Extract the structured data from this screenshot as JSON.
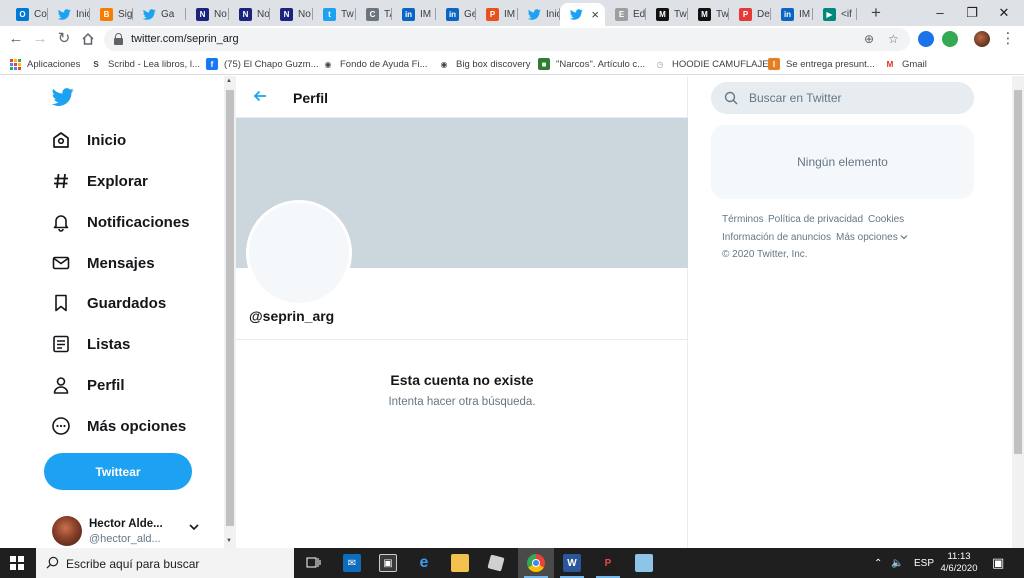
{
  "browser": {
    "tabs": [
      {
        "label": "Co",
        "icon": "outlook-icon",
        "color": "#0078d4",
        "glyph": "O"
      },
      {
        "label": "Inic",
        "icon": "twitter-icon",
        "color": "#1da1f2",
        "glyph": ""
      },
      {
        "label": "Sig",
        "icon": "blogger-icon",
        "color": "#f57d00",
        "glyph": "B"
      },
      {
        "label": "Ga",
        "icon": "twitter-icon",
        "color": "#1da1f2",
        "glyph": ""
      },
      {
        "label": "No",
        "icon": "news-icon",
        "color": "#1a237e",
        "glyph": "N"
      },
      {
        "label": "No",
        "icon": "news-icon",
        "color": "#1a237e",
        "glyph": "N"
      },
      {
        "label": "No",
        "icon": "news-icon",
        "color": "#1a237e",
        "glyph": "N"
      },
      {
        "label": "Tw",
        "icon": "twitter-square-icon",
        "color": "#1da1f2",
        "glyph": "t"
      },
      {
        "label": "TA",
        "icon": "ring-icon",
        "color": "#6c757d",
        "glyph": "C"
      },
      {
        "label": "IM",
        "icon": "linkedin-icon",
        "color": "#0a66c2",
        "glyph": "in"
      },
      {
        "label": "Ge",
        "icon": "linkedin-icon",
        "color": "#0a66c2",
        "glyph": "in"
      },
      {
        "label": "IM",
        "icon": "flag-icon",
        "color": "#e8501d",
        "glyph": "P"
      },
      {
        "label": "Inic",
        "icon": "twitter-icon",
        "color": "#1da1f2",
        "glyph": ""
      },
      {
        "label": "",
        "icon": "twitter-icon",
        "color": "#1da1f2",
        "glyph": "",
        "active": true
      },
      {
        "label": "Ed",
        "icon": "document-icon",
        "color": "#9e9e9e",
        "glyph": "E"
      },
      {
        "label": "Tw",
        "icon": "medium-icon",
        "color": "#111111",
        "glyph": "M"
      },
      {
        "label": "Tw",
        "icon": "medium-icon",
        "color": "#111111",
        "glyph": "M"
      },
      {
        "label": "De",
        "icon": "pdf-icon",
        "color": "#e53935",
        "glyph": "P"
      },
      {
        "label": "IM",
        "icon": "linkedin-icon",
        "color": "#0a66c2",
        "glyph": "in"
      },
      {
        "label": "<if",
        "icon": "bookmark-icon",
        "color": "#00897b",
        "glyph": "▶"
      }
    ],
    "url": "twitter.com/seprin_arg",
    "bookmarks": [
      {
        "label": "Aplicaciones",
        "icon": "apps-grid-icon"
      },
      {
        "label": "Scribd - Lea libros, l...",
        "icon": "scribd-icon",
        "color": "#444444",
        "glyph": "S"
      },
      {
        "label": "(75) El Chapo Guzm...",
        "icon": "facebook-icon",
        "color": "#1877f2",
        "glyph": "f"
      },
      {
        "label": "Fondo de Ayuda Fi...",
        "icon": "globe-icon",
        "color": "#444444",
        "glyph": "◉"
      },
      {
        "label": "Big box discovery",
        "icon": "globe-icon",
        "color": "#444444",
        "glyph": "◉"
      },
      {
        "label": "\"Narcos\". Artículo c...",
        "icon": "article-icon",
        "color": "#2e7d32",
        "glyph": "■"
      },
      {
        "label": "HOODIE CAMUFLAJE",
        "icon": "clock-icon",
        "color": "#9e9e9e",
        "glyph": "◷"
      },
      {
        "label": "Se entrega presunt...",
        "icon": "news-icon",
        "color": "#e67e22",
        "glyph": "I"
      },
      {
        "label": "Gmail",
        "icon": "gmail-icon",
        "color": "#d93025",
        "glyph": "M"
      }
    ]
  },
  "nav": {
    "items": [
      {
        "label": "Inicio",
        "icon": "home-icon"
      },
      {
        "label": "Explorar",
        "icon": "hashtag-icon"
      },
      {
        "label": "Notificaciones",
        "icon": "bell-icon"
      },
      {
        "label": "Mensajes",
        "icon": "envelope-icon"
      },
      {
        "label": "Guardados",
        "icon": "bookmark-icon"
      },
      {
        "label": "Listas",
        "icon": "list-icon"
      },
      {
        "label": "Perfil",
        "icon": "person-icon"
      },
      {
        "label": "Más opciones",
        "icon": "more-circle-icon"
      }
    ],
    "tweet_button": "Twittear",
    "account": {
      "name": "Hector Alde...",
      "handle": "@hector_ald..."
    }
  },
  "profile": {
    "header_title": "Perfil",
    "handle": "@seprin_arg",
    "error_title": "Esta cuenta no existe",
    "error_subtitle": "Intenta hacer otra búsqueda."
  },
  "sidebar": {
    "search_placeholder": "Buscar en Twitter",
    "empty_text": "Ningún elemento",
    "footer": {
      "terms": "Términos",
      "privacy": "Política de privacidad",
      "cookies": "Cookies",
      "ads_info": "Información de anuncios",
      "more": "Más opciones",
      "copyright": "© 2020 Twitter, Inc."
    }
  },
  "taskbar": {
    "search_placeholder": "Escribe aquí para buscar",
    "language": "ESP",
    "time": "11:13",
    "date": "4/6/2020"
  },
  "colors": {
    "twitter_blue": "#1da1f2",
    "banner": "#ccd6dd"
  }
}
